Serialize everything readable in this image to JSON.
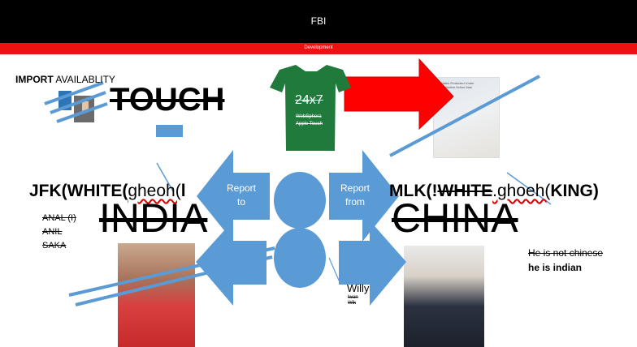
{
  "header": {
    "title": "FBI"
  },
  "banner": {
    "label": "Development"
  },
  "import": {
    "bold": "IMPORT",
    "rest": " AVAILABLITY"
  },
  "touch": {
    "text": "TOUCH"
  },
  "tshirt": {
    "text": "24x7",
    "sub1": "WebSphera",
    "sub2": "Apple Touch"
  },
  "map": {
    "title_line1": "States Protected Under",
    "title_line2": "Distinctive Action Mae"
  },
  "jfk": {
    "bold": "JFK(WHITE(",
    "light": "gheoh(",
    "tail": "l"
  },
  "mlk": {
    "bold": "MLK(!",
    "strike": "WHITE",
    "light": ".ghoeh(",
    "tail": "KING)"
  },
  "arrows": {
    "left_label_1": "Report",
    "left_label_2": "to",
    "right_label_1": "Report",
    "right_label_2": "from"
  },
  "countries": {
    "left": "INDIA",
    "right": "CHINA"
  },
  "names": [
    "ANAL (I)",
    "ANIL",
    "SAKA"
  ],
  "notes": {
    "line1": "He is not chinese",
    "line2": "he is indian"
  },
  "willy": {
    "name": "Willy",
    "sub1": "Iwan",
    "sub2": "Wik"
  },
  "colors": {
    "topbar": "#000000",
    "banner": "#ee1111",
    "shape_blue": "#5b9bd5",
    "shirt_green": "#1f7a3c",
    "arrow_red": "#ff0000"
  }
}
